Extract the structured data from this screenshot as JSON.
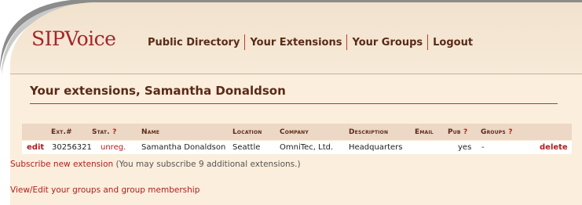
{
  "logo": {
    "text_s": "SIP",
    "text_v": "Voice"
  },
  "nav": {
    "items": [
      "Public Directory",
      "Your Extensions",
      "Your Groups",
      "Logout"
    ]
  },
  "page": {
    "title": "Your extensions, Samantha Donaldson"
  },
  "table": {
    "headers": {
      "ext": "Ext.#",
      "stat": "Stat.",
      "name": "Name",
      "location": "Location",
      "company": "Company",
      "description": "Description",
      "email": "Email",
      "pub": "Pub",
      "groups": "Groups",
      "help": "?"
    },
    "rows": [
      {
        "edit": "edit",
        "ext": "30256321",
        "stat": "unreg.",
        "name": "Samantha Donaldson",
        "location": "Seattle",
        "company": "OmniTec, Ltd.",
        "description": "Headquarters",
        "email": "",
        "pub": "yes",
        "groups": "-",
        "delete": "delete"
      }
    ]
  },
  "subscribe": {
    "link": "Subscribe new extension",
    "note": "(You may subscribe 9 additional extensions.)"
  },
  "groups_link": "View/Edit your groups and group membership",
  "colors": {
    "accent": "#b01e1e",
    "panel": "#fbeedc",
    "text": "#5a2a18"
  }
}
